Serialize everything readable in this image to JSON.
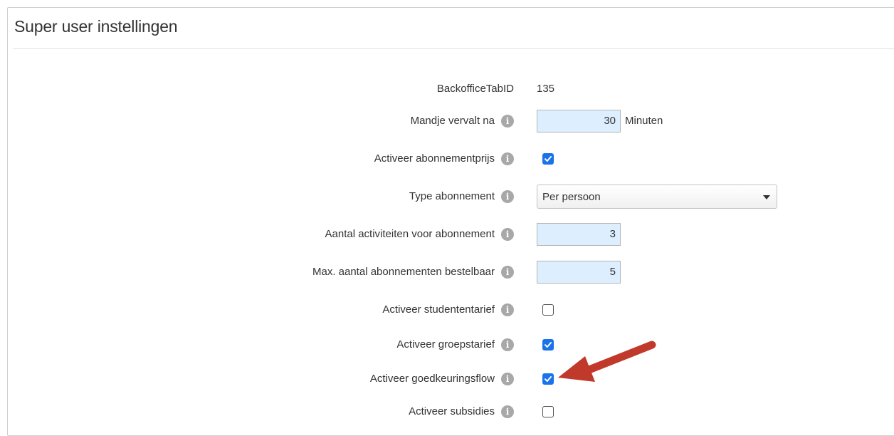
{
  "panel": {
    "title": "Super user instellingen"
  },
  "settings": {
    "backoffice_tab_id": {
      "label": "BackofficeTabID",
      "value": "135"
    },
    "mandje_vervalt": {
      "label": "Mandje vervalt na",
      "value": "30",
      "unit": "Minuten"
    },
    "activeer_abonnementprijs": {
      "label": "Activeer abonnementprijs",
      "checked": true
    },
    "type_abonnement": {
      "label": "Type abonnement",
      "selected": "Per persoon"
    },
    "aantal_activiteiten": {
      "label": "Aantal activiteiten voor abonnement",
      "value": "3"
    },
    "max_abonnementen": {
      "label": "Max. aantal abonnementen bestelbaar",
      "value": "5"
    },
    "activeer_studententarief": {
      "label": "Activeer studententarief",
      "checked": false
    },
    "activeer_groepstarief": {
      "label": "Activeer groepstarief",
      "checked": true
    },
    "activeer_goedkeuringsflow": {
      "label": "Activeer goedkeuringsflow",
      "checked": true
    },
    "activeer_subsidies": {
      "label": "Activeer subsidies",
      "checked": false
    }
  },
  "icons": {
    "info": "info-icon",
    "annotation": "red-arrow-annotation"
  },
  "colors": {
    "input_background": "#ddeeff",
    "checkbox_checked": "#1a73e8",
    "annotation_arrow": "#c0392b"
  }
}
